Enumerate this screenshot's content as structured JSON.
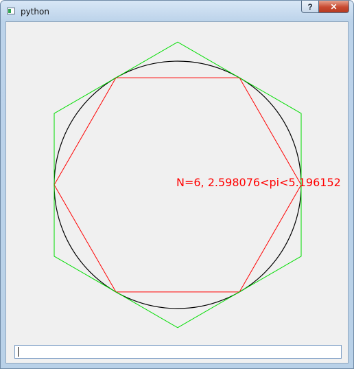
{
  "window": {
    "title": "python"
  },
  "titlebar": {
    "help_label": "?",
    "close_label": "✕"
  },
  "canvas": {
    "label": "N=6, 2.598076<pi<5.196152",
    "sides": 6,
    "lower_bound": 2.598076,
    "upper_bound": 5.196152,
    "colors": {
      "circle": "#000000",
      "inscribed_polygon": "#ff0000",
      "circumscribed_polygon": "#00dd00",
      "label": "#ff0000"
    }
  },
  "input": {
    "value": ""
  }
}
